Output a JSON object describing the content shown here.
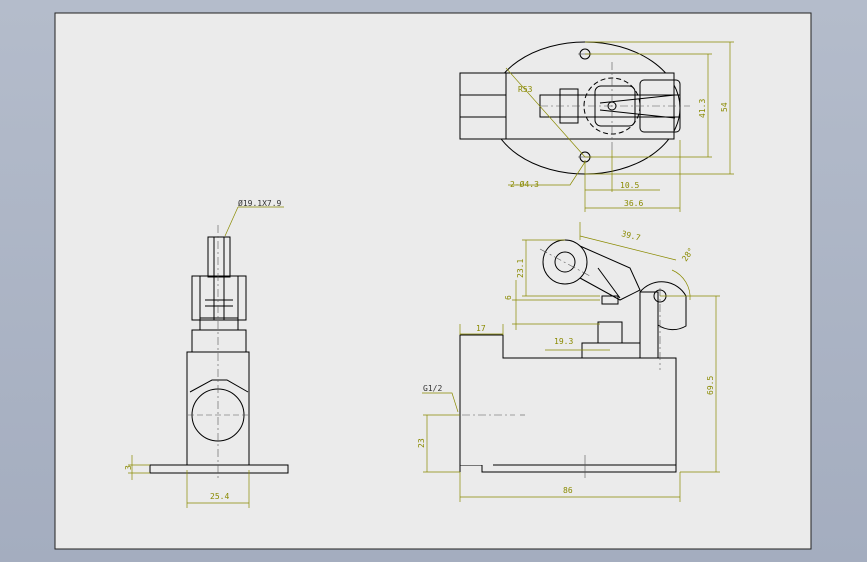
{
  "drawing": {
    "sheet_color": "#ebebeb",
    "part_line_color": "#000000",
    "dimension_color": "#8a8a00",
    "center_line_color": "#555555",
    "top_view": {
      "radius_label": "R53",
      "hole_label": "2-Ø4.3",
      "dims": [
        "10.5",
        "36.6",
        "41.3",
        "54"
      ]
    },
    "front_view": {
      "roller_label": "Ø19.1X7.9",
      "base_width": "25.4",
      "base_thickness": "3"
    },
    "side_view": {
      "arm_length": "39.7",
      "roller_height": "23.1",
      "roller_offset": "6",
      "angle": "28°",
      "plunger_offset": "19.3",
      "top_step": "17",
      "thread_label": "G1/2",
      "thread_height": "23",
      "overall_height": "69.5",
      "overall_length": "86"
    }
  }
}
